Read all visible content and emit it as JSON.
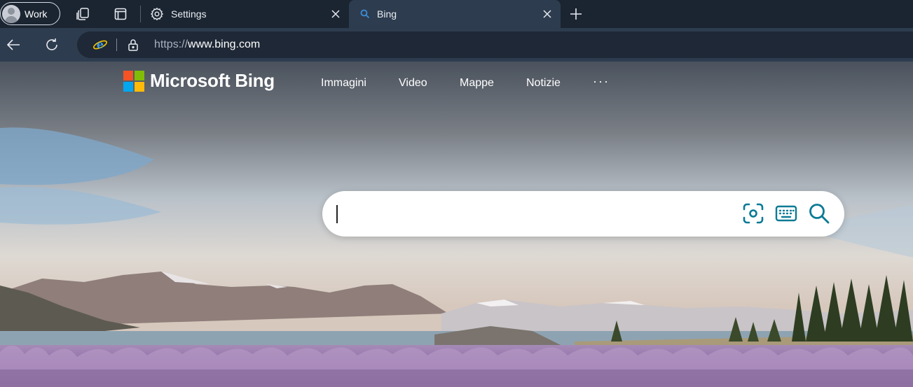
{
  "browser": {
    "profile_label": "Work",
    "tabs": [
      {
        "label": "Settings",
        "active": false
      },
      {
        "label": "Bing",
        "active": true
      }
    ],
    "address": {
      "protocol": "https://",
      "host": "www.bing.com"
    }
  },
  "bing": {
    "brand": "Microsoft Bing",
    "nav": [
      "Immagini",
      "Video",
      "Mappe",
      "Notizie"
    ],
    "more": "···",
    "search": {
      "value": "",
      "placeholder": ""
    }
  },
  "colors": {
    "ms_red": "#f35325",
    "ms_green": "#81bc06",
    "ms_blue": "#05a6f0",
    "ms_yellow": "#ffba08",
    "bing_accent": "#0b7a95"
  },
  "icons": [
    "workspaces-icon",
    "tab-actions-icon",
    "gear-icon",
    "bing-search-icon",
    "close-icon",
    "plus-icon",
    "back-arrow-icon",
    "refresh-icon",
    "ie-mode-icon",
    "lock-icon",
    "visual-search-icon",
    "keyboard-icon",
    "search-icon"
  ]
}
